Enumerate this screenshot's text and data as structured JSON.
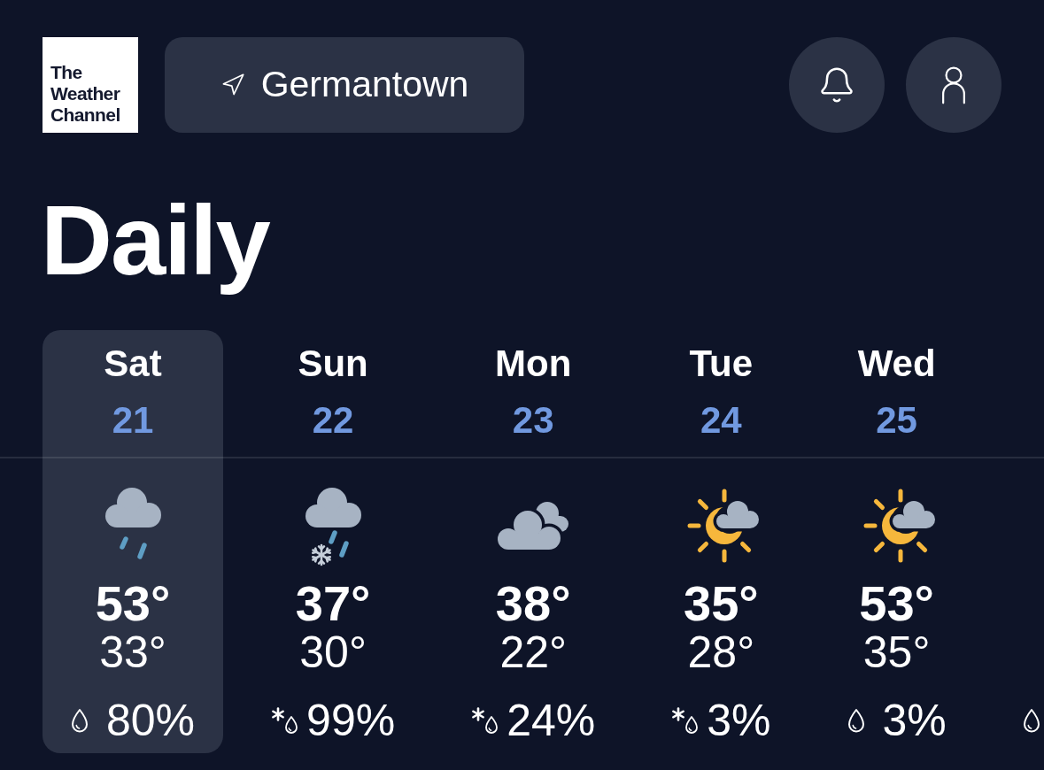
{
  "header": {
    "logo_text": "The Weather Channel",
    "location": "Germantown"
  },
  "title": "Daily",
  "days": [
    {
      "day": "Sat",
      "date": "21",
      "weather": {
        "kind": "rain"
      },
      "high": "53°",
      "low": "33°",
      "precip": {
        "kind": "rain",
        "value": "80%"
      },
      "selected": true
    },
    {
      "day": "Sun",
      "date": "22",
      "weather": {
        "kind": "snow-rain"
      },
      "high": "37°",
      "low": "30°",
      "precip": {
        "kind": "mix",
        "value": "99%"
      },
      "selected": false
    },
    {
      "day": "Mon",
      "date": "23",
      "weather": {
        "kind": "cloudy"
      },
      "high": "38°",
      "low": "22°",
      "precip": {
        "kind": "mix",
        "value": "24%"
      },
      "selected": false
    },
    {
      "day": "Tue",
      "date": "24",
      "weather": {
        "kind": "partly-cloudy"
      },
      "high": "35°",
      "low": "28°",
      "precip": {
        "kind": "mix",
        "value": "3%"
      },
      "selected": false
    },
    {
      "day": "Wed",
      "date": "25",
      "weather": {
        "kind": "partly-cloudy"
      },
      "high": "53°",
      "low": "35°",
      "precip": {
        "kind": "rain",
        "value": "3%"
      },
      "selected": false
    },
    {
      "precip": {
        "kind": "rain"
      },
      "selected": false
    }
  ]
}
